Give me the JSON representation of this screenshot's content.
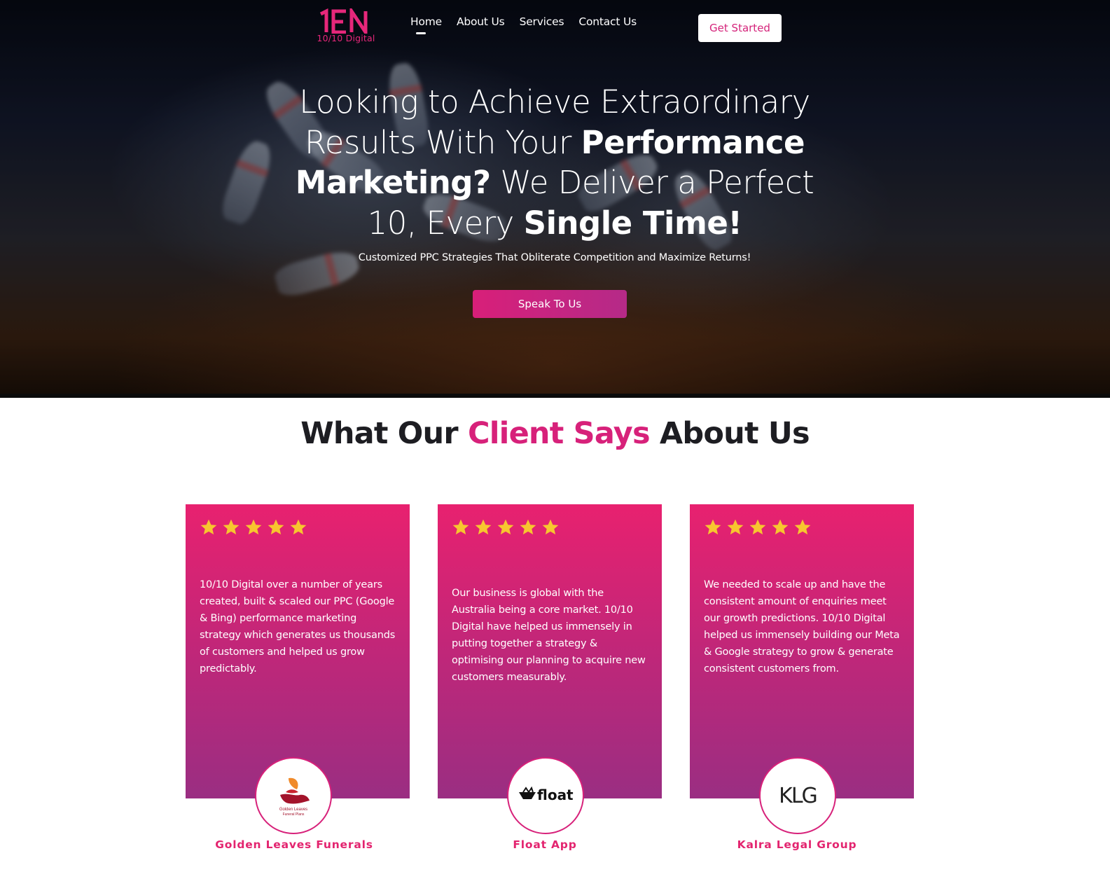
{
  "header": {
    "logo_text": "10/10 Digital",
    "logo_mark": "1ƎN",
    "nav": [
      {
        "label": "Home"
      },
      {
        "label": "About Us"
      },
      {
        "label": "Services"
      },
      {
        "label": "Contact Us"
      }
    ],
    "cta_label": "Get Started"
  },
  "hero": {
    "title_parts": [
      "Looking to Achieve Extraordinary Results With Your ",
      "Performance Marketing?",
      " We Deliver a Perfect 10, Every ",
      "Single Time!"
    ],
    "subtitle": "Customized PPC Strategies That Obliterate Competition and Maximize Returns!",
    "button_label": "Speak To Us"
  },
  "testimonials": {
    "title_pre": "What Our ",
    "title_accent": "Client Says",
    "title_post": " About Us",
    "items": [
      {
        "rating": 5,
        "quote": "10/10 Digital over a number of years created, built & scaled our PPC (Google & Bing) performance marketing strategy which generates us thousands of customers and helped us grow predictably.",
        "client": "Golden Leaves Funerals",
        "logo_text": "Golden Leaves Funeral Plans"
      },
      {
        "rating": 5,
        "quote": "Our business is global with the Australia being a core market. 10/10 Digital have helped us immensely in putting together a strategy & optimising our planning to acquire new customers measurably.",
        "client": "Float App",
        "logo_text": "float"
      },
      {
        "rating": 5,
        "quote": "We needed to scale up and have the consistent amount of enquiries meet our growth predictions. 10/10 Digital helped us immensely building our Meta & Google strategy to grow & generate consistent customers from.",
        "client": "Kalra Legal Group",
        "logo_text": "KLG"
      }
    ]
  },
  "colors": {
    "accent": "#d7217a",
    "star": "#f7c62f",
    "card_top": "#e8216f",
    "card_bottom": "#9a2e82"
  }
}
